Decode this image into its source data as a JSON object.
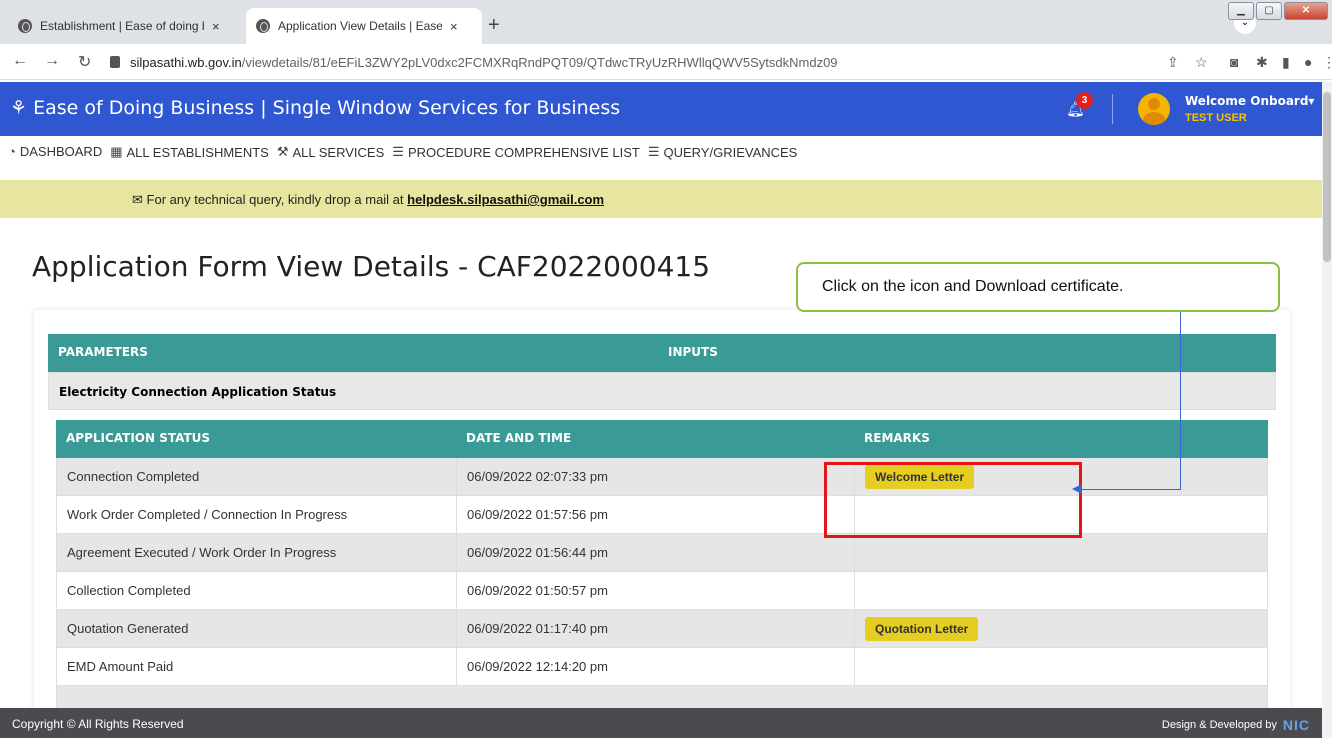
{
  "browser": {
    "tabs": [
      {
        "title": "Establishment | Ease of doing bus",
        "close": "×"
      },
      {
        "title": "Application View Details | Ease of",
        "close": "×"
      }
    ],
    "new_tab": "+",
    "url_host": "silpasathi.wb.gov.in",
    "url_path": "/viewdetails/81/eEFiL3ZWY2pLV0dxc2FCMXRqRndPQT09/QTdwcTRyUzRHWllqQWV5SytsdkNmdz09"
  },
  "header": {
    "brand": "Ease of Doing Business | Single Window Services for Business",
    "notification_count": "3",
    "welcome": "Welcome Onboard",
    "user": "TEST USER"
  },
  "menu": {
    "items": [
      "DASHBOARD",
      "ALL ESTABLISHMENTS",
      "ALL SERVICES",
      "PROCEDURE COMPREHENSIVE LIST",
      "QUERY/GRIEVANCES"
    ]
  },
  "notice": {
    "text": "For any technical query, kindly drop a mail at",
    "email": "helpdesk.silpasathi@gmail.com"
  },
  "page": {
    "title": "Application Form View Details - CAF2022000415",
    "callout": "Click on the icon and Download certificate."
  },
  "params_table": {
    "col1": "PARAMETERS",
    "col2": "INPUTS",
    "section": "Electricity Connection Application Status"
  },
  "status_table": {
    "headers": [
      "APPLICATION STATUS",
      "DATE AND TIME",
      "REMARKS"
    ],
    "rows": [
      {
        "status": "Connection Completed",
        "datetime": "06/09/2022 02:07:33 pm",
        "remark": "Welcome Letter"
      },
      {
        "status": "Work Order Completed / Connection In Progress",
        "datetime": "06/09/2022 01:57:56 pm",
        "remark": ""
      },
      {
        "status": "Agreement Executed / Work Order In Progress",
        "datetime": "06/09/2022 01:56:44 pm",
        "remark": ""
      },
      {
        "status": "Collection Completed",
        "datetime": "06/09/2022 01:50:57 pm",
        "remark": ""
      },
      {
        "status": "Quotation Generated",
        "datetime": "06/09/2022 01:17:40 pm",
        "remark": "Quotation Letter"
      },
      {
        "status": "EMD Amount Paid",
        "datetime": "06/09/2022 12:14:20 pm",
        "remark": ""
      }
    ]
  },
  "footer": {
    "copyright": "Copyright © All Rights Reserved",
    "credit": "Design & Developed by",
    "logo": "NIC"
  },
  "colors": {
    "header_blue": "#2f57d1",
    "teal": "#3a9a95",
    "remark_yellow": "#e5cd22",
    "highlight_red": "#e3151a"
  }
}
